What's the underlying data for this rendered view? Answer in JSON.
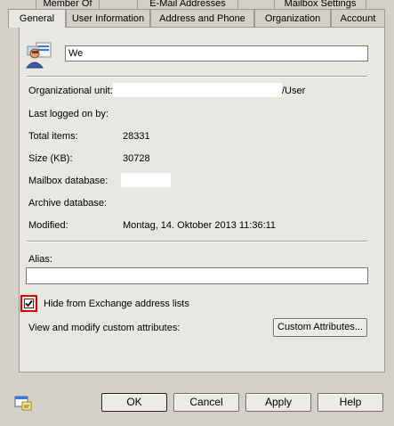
{
  "tabs_row1": [
    "Member Of",
    "E-Mail Addresses",
    "Mailbox Settings"
  ],
  "tabs_row2": [
    "General",
    "User Information",
    "Address and Phone",
    "Organization",
    "Account"
  ],
  "name_value": "We",
  "fields": {
    "org_unit_label": "Organizational unit:",
    "org_unit_suffix": "/User",
    "last_logged_label": "Last logged on by:",
    "total_items_label": "Total items:",
    "total_items_value": "28331",
    "size_label": "Size (KB):",
    "size_value": "30728",
    "mailbox_db_label": "Mailbox database:",
    "archive_db_label": "Archive database:",
    "modified_label": "Modified:",
    "modified_value": "Montag, 14. Oktober 2013 11:36:11"
  },
  "alias": {
    "label": "Alias:",
    "value": ""
  },
  "hide_checkbox": {
    "label": "Hide from Exchange address lists",
    "checked": true
  },
  "custom_attr": {
    "text": "View and modify custom attributes:",
    "button": "Custom Attributes..."
  },
  "buttons": {
    "ok": "OK",
    "cancel": "Cancel",
    "apply": "Apply",
    "help": "Help"
  },
  "colors": {
    "highlight_box": "#e00000",
    "window_bg": "#d4d0c8",
    "panel_bg": "#e9e7e1"
  }
}
